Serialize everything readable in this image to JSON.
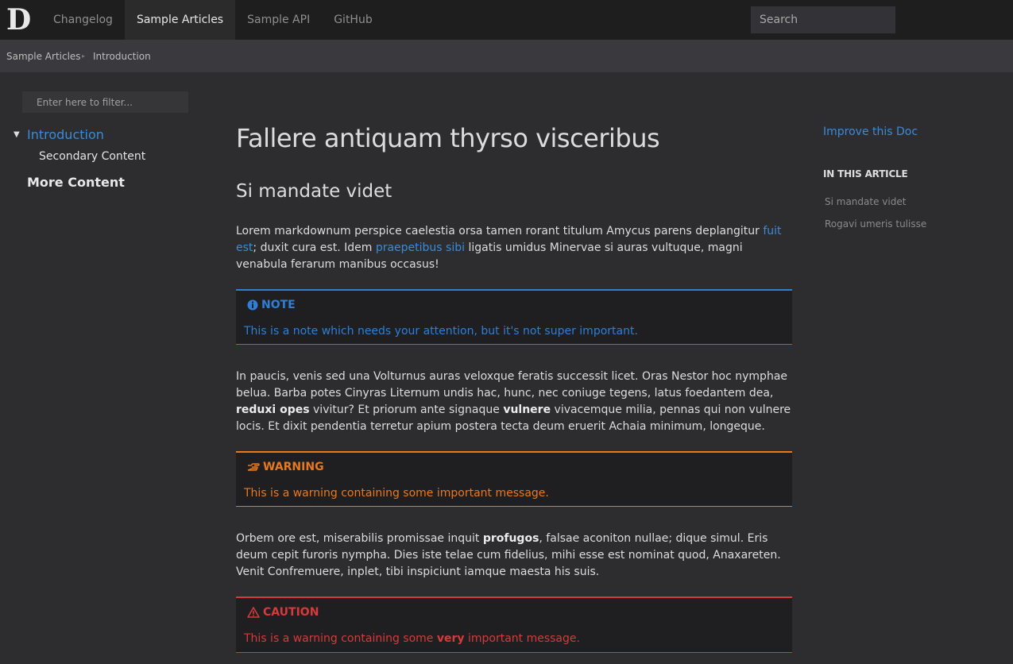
{
  "header": {
    "logo": "D",
    "nav": [
      "Changelog",
      "Sample Articles",
      "Sample API",
      "GitHub"
    ],
    "active_nav": "Sample Articles",
    "search_placeholder": "Search"
  },
  "breadcrumb": [
    "Sample Articles",
    "Introduction"
  ],
  "sidebar": {
    "filter_placeholder": "Enter here to filter...",
    "items": [
      "Introduction",
      "Secondary Content",
      "More Content"
    ]
  },
  "article": {
    "title": "Fallere antiquam thyrso visceribus",
    "subtitle": "Si mandate videt",
    "p1": {
      "a": "Lorem markdownum perspice caelestia orsa tamen rorant titulum Amycus parens deplangitur ",
      "link1": "fuit est",
      "b": "; duxit cura est. Idem ",
      "link2": "praepetibus sibi",
      "c": " ligatis umidus Minervae si auras vultuque, magni venabula ferarum manibus occasus!"
    },
    "note": {
      "label": "NOTE",
      "text": "This is a note which needs your attention, but it's not super important."
    },
    "p2": {
      "a": "In paucis, venis sed una Volturnus auras veloxque feratis successit licet. Oras Nestor hoc nymphae belua. Barba potes Cinyras Liternum undis hac, hunc, nec coniuge tegens, latus foedantem dea, ",
      "b1": "reduxi opes",
      "b": " vivitur? Et priorum ante signaque ",
      "b2": "vulnere",
      "c": " vivacemque milia, pennas qui non vulnere locis. Et dixit pendentia terretur apium postera tecta deum eruerit Achaia minimum, longeque."
    },
    "warning": {
      "label": "WARNING",
      "text": "This is a warning containing some important message."
    },
    "p3": {
      "a": "Orbem ore est, miserabilis promissae inquit ",
      "b1": "profugos",
      "b": ", falsae aconiton nullae; dique simul. Eris deum cepit furoris nympha. Dies iste telae cum fidelius, mihi esse est nominat quod, Anaxareten. Venit Confremuere, inplet, tibi inspiciunt iamque maesta his suis."
    },
    "caution": {
      "label": "CAUTION",
      "text_a": "This is a warning containing some ",
      "text_b": "very",
      "text_c": " important message."
    }
  },
  "affix": {
    "improve": "Improve this Doc",
    "heading": "IN THIS ARTICLE",
    "links": [
      "Si mandate videt",
      "Rogavi umeris tulisse"
    ]
  },
  "colors": {
    "link": "#3a8bd9",
    "note": "#2f7fd6",
    "warning": "#e8791e",
    "caution": "#d63a3a"
  },
  "icons": {
    "note": "info-circle-icon",
    "warning": "hand-pointing-icon",
    "caution": "warning-triangle-icon"
  }
}
